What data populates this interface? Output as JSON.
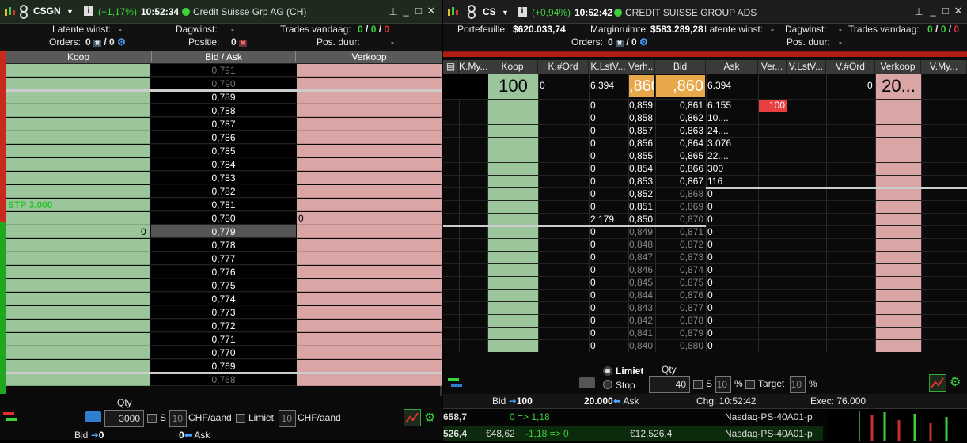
{
  "left": {
    "symbol": "CSGN",
    "change": "(+1,17%)",
    "time": "10:52:34",
    "name": "Credit Suisse Grp AG (CH)",
    "stats": {
      "latente_label": "Latente winst:",
      "latente_val": "-",
      "dagwinst_label": "Dagwinst:",
      "dagwinst_val": "-",
      "trades_label": "Trades vandaag:",
      "trades_a": "0",
      "trades_b": "0",
      "trades_c": "0",
      "orders_label": "Orders:",
      "orders_a": "0",
      "orders_b": "0",
      "positie_label": "Positie:",
      "positie_val": "0",
      "posduur_label": "Pos. duur:",
      "posduur_val": "-"
    },
    "columns": {
      "koop": "Koop",
      "bidask": "Bid / Ask",
      "verkoop": "Verkoop"
    },
    "stp_label": "STP 3.000",
    "bid_qty_at_779": "0",
    "ask_qty_at_780": "0",
    "prices": [
      "0,791",
      "0,790",
      "0,789",
      "0,788",
      "0,787",
      "0,786",
      "0,785",
      "0,784",
      "0,783",
      "0,782",
      "0,781",
      "0,780",
      "0,779",
      "0,778",
      "0,777",
      "0,776",
      "0,775",
      "0,774",
      "0,773",
      "0,772",
      "0,771",
      "0,770",
      "0,769",
      "0,768"
    ],
    "footer": {
      "qty_label": "Qty",
      "qty_value": "3000",
      "s_label": "S",
      "s_value": "10",
      "chf_label": "CHF/aand",
      "limiet_label": "Limiet",
      "limiet_value": "10",
      "chf_label2": "CHF/aand",
      "bid_label": "Bid",
      "bid_value": "0",
      "ask_value": "0",
      "ask_label": "Ask"
    }
  },
  "right": {
    "symbol": "CS",
    "change": "(+0,94%)",
    "time": "10:52:42",
    "name": "CREDIT SUISSE GROUP ADS",
    "stats": {
      "portefeuille_label": "Portefeuille:",
      "portefeuille_val": "$620.033,74",
      "margin_label": "Marginruimte",
      "margin_val": "$583.289,28",
      "latente_label": "Latente winst:",
      "latente_val": "-",
      "dagwinst_label": "Dagwinst:",
      "dagwinst_val": "-",
      "trades_label": "Trades vandaag:",
      "trades_a": "0",
      "trades_b": "0",
      "trades_c": "0",
      "orders_label": "Orders:",
      "orders_a": "0",
      "orders_b": "0",
      "posduur_label": "Pos. duur:",
      "posduur_val": "-"
    },
    "columns": [
      "K.My...",
      "Koop",
      "K.#Ord",
      "K.LstV...",
      "Verh...",
      "Bid",
      "Ask",
      "Ver...",
      "V.LstV...",
      "V.#Ord",
      "Verkoop",
      "V.My..."
    ],
    "top_row": {
      "koop": "100",
      "kord": "0",
      "verh": "6.394",
      "bid": ",860",
      "ask": ",860",
      "ver": "6.394",
      "vord": "0",
      "verkoop": "20..."
    },
    "bid_rows": [
      {
        "verh": "0",
        "bid": "0,859"
      },
      {
        "verh": "0",
        "bid": "0,858"
      },
      {
        "verh": "0",
        "bid": "0,857"
      },
      {
        "verh": "0",
        "bid": "0,856"
      },
      {
        "verh": "0",
        "bid": "0,855"
      },
      {
        "verh": "0",
        "bid": "0,854"
      },
      {
        "verh": "0",
        "bid": "0,853"
      },
      {
        "verh": "0",
        "bid": "0,852"
      },
      {
        "verh": "0",
        "bid": "0,851"
      },
      {
        "verh": "2.179",
        "bid": "0,850"
      },
      {
        "verh": "0",
        "bid": "0,849"
      },
      {
        "verh": "0",
        "bid": "0,848"
      },
      {
        "verh": "0",
        "bid": "0,847"
      },
      {
        "verh": "0",
        "bid": "0,846"
      },
      {
        "verh": "0",
        "bid": "0,845"
      },
      {
        "verh": "0",
        "bid": "0,844"
      },
      {
        "verh": "0",
        "bid": "0,843"
      },
      {
        "verh": "0",
        "bid": "0,842"
      },
      {
        "verh": "0",
        "bid": "0,841"
      },
      {
        "verh": "0",
        "bid": "0,840"
      }
    ],
    "ask_rows": [
      {
        "ask": "0,861",
        "ver": "6.155",
        "lst": "100"
      },
      {
        "ask": "0,862",
        "ver": "10...."
      },
      {
        "ask": "0,863",
        "ver": "24...."
      },
      {
        "ask": "0,864",
        "ver": "3.076"
      },
      {
        "ask": "0,865",
        "ver": "22...."
      },
      {
        "ask": "0,866",
        "ver": "300"
      },
      {
        "ask": "0,867",
        "ver": "116"
      },
      {
        "ask": "0,868",
        "ver": "0"
      },
      {
        "ask": "0,869",
        "ver": "0"
      },
      {
        "ask": "0,870",
        "ver": "0"
      },
      {
        "ask": "0,871",
        "ver": "0"
      },
      {
        "ask": "0,872",
        "ver": "0"
      },
      {
        "ask": "0,873",
        "ver": "0"
      },
      {
        "ask": "0,874",
        "ver": "0"
      },
      {
        "ask": "0,875",
        "ver": "0"
      },
      {
        "ask": "0,876",
        "ver": "0"
      },
      {
        "ask": "0,877",
        "ver": "0"
      },
      {
        "ask": "0,878",
        "ver": "0"
      },
      {
        "ask": "0,879",
        "ver": "0"
      },
      {
        "ask": "0,880",
        "ver": "0"
      }
    ],
    "footer": {
      "limiet_label": "Limiet",
      "stop_label": "Stop",
      "qty_label": "Qty",
      "qty_value": "40",
      "s_label": "S",
      "s_value": "10",
      "pct": "%",
      "target_label": "Target",
      "target_value": "10",
      "pct2": "%",
      "bid_label": "Bid",
      "bid_value": "100",
      "ask_value": "20.000",
      "ask_label": "Ask",
      "chg_label": "Chg:",
      "chg_value": "10:52:42",
      "exec_label": "Exec:",
      "exec_value": "76.000"
    }
  },
  "bottom": {
    "row1": {
      "c1": "658,7",
      "c2": "0 => 1,18",
      "c3": "Nasdaq-PS-40A01-p"
    },
    "row2": {
      "c1": "526,4",
      "c2": "€48,62",
      "c3": "-1,18 => 0",
      "c4": "€12.526,4",
      "c5": "Nasdaq-PS-40A01-p"
    }
  },
  "colors": {
    "bid_green": "#9bc59b",
    "ask_pink": "#d9a5a5",
    "best_orange": "#e8a84a",
    "up_green": "#3cd23c"
  }
}
